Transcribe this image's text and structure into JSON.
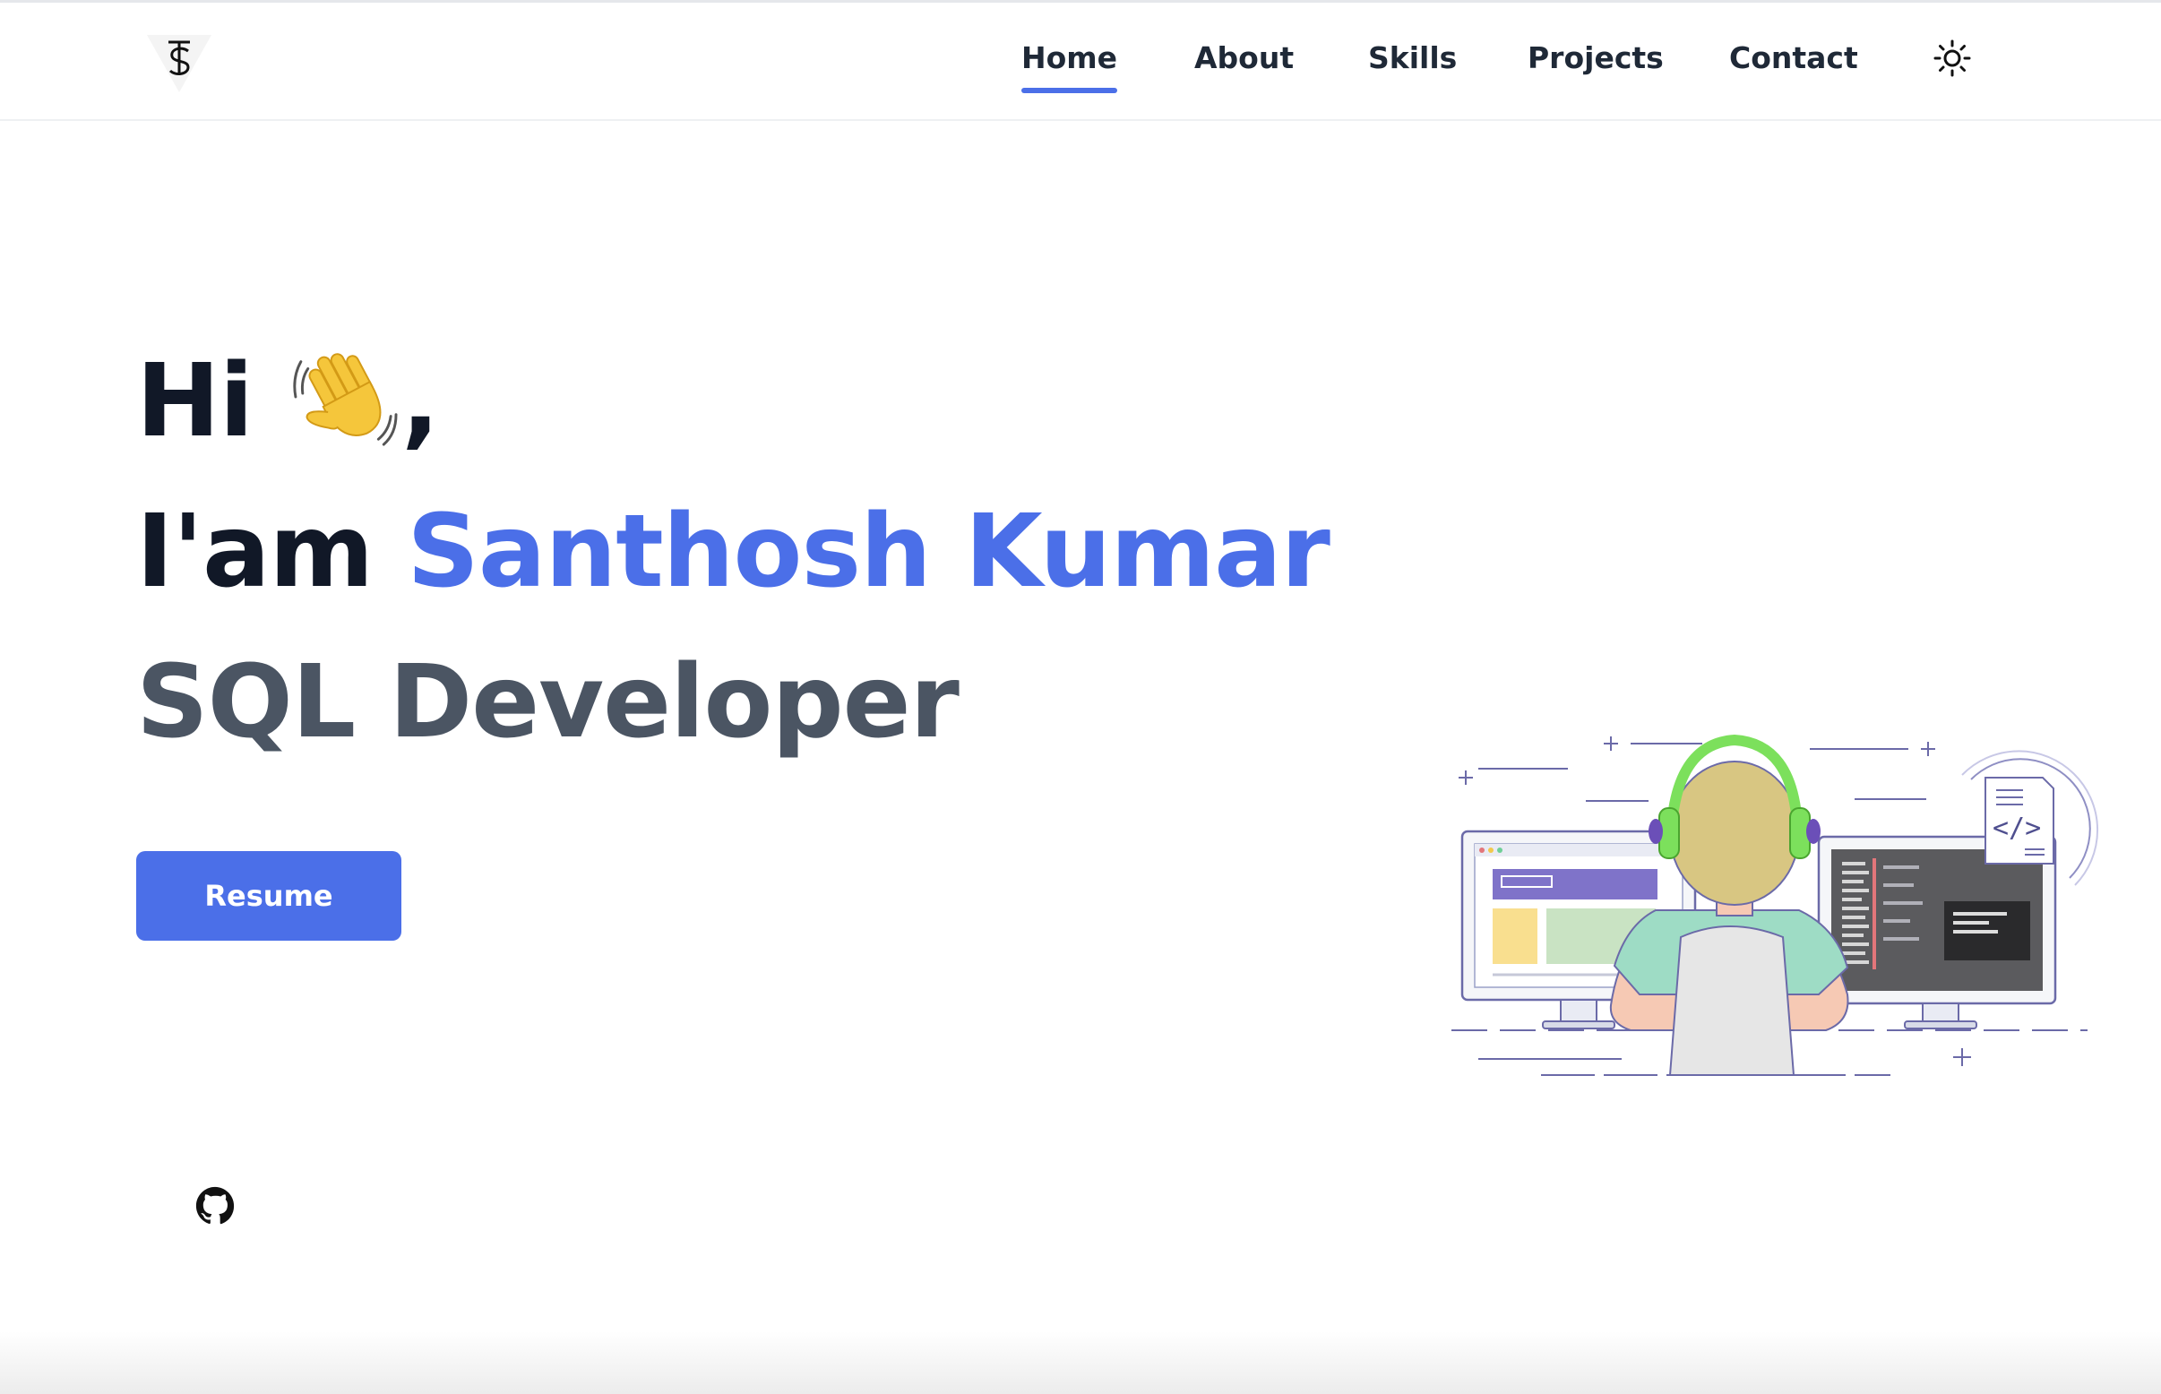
{
  "nav": {
    "items": [
      {
        "label": "Home",
        "active": true
      },
      {
        "label": "About",
        "active": false
      },
      {
        "label": "Skills",
        "active": false
      },
      {
        "label": "Projects",
        "active": false
      },
      {
        "label": "Contact",
        "active": false
      }
    ],
    "theme_icon": "sun-icon"
  },
  "logo": {
    "icon": "logo-monogram-icon"
  },
  "hero": {
    "greeting": "Hi",
    "greeting_suffix": ",",
    "greeting_icon": "waving-hand-icon",
    "intro_prefix": "I'am",
    "name": "Santhosh Kumar",
    "role": "SQL Developer",
    "resume_label": "Resume"
  },
  "social": {
    "github_icon": "github-icon"
  },
  "illustration": {
    "code_label": "</>"
  },
  "colors": {
    "accent": "#4b6fe8",
    "text_dark": "#111827",
    "text_muted": "#4b5563",
    "nav_text": "#1f2937"
  }
}
